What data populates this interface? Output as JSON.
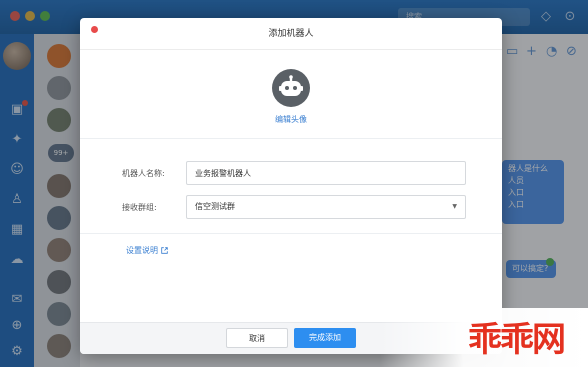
{
  "dialog": {
    "title": "添加机器人",
    "edit_avatar_label": "编辑头像",
    "robot_name_label": "机器人名称:",
    "robot_name_value": "业务报警机器人",
    "receive_group_label": "接收群组:",
    "receive_group_value": "信空测试群",
    "settings_link": "设置说明",
    "cancel_label": "取消",
    "confirm_label": "完成添加"
  },
  "background": {
    "search_placeholder": "搜索...",
    "conv_badge": "99+",
    "bubble_lines": [
      "器人是什么",
      "人员",
      "入口",
      "入口"
    ],
    "bubble_reply": "可以搞定?"
  },
  "watermark": "乖乖网",
  "colors": {
    "accent_blue": "#2d8ef0",
    "titlebar_blue": "#1b67b7",
    "close_red": "#e84b4b",
    "watermark_red": "#e4311f"
  },
  "icons": [
    "robot-icon",
    "external-link-icon",
    "chevron-down-icon",
    "close-icon"
  ]
}
